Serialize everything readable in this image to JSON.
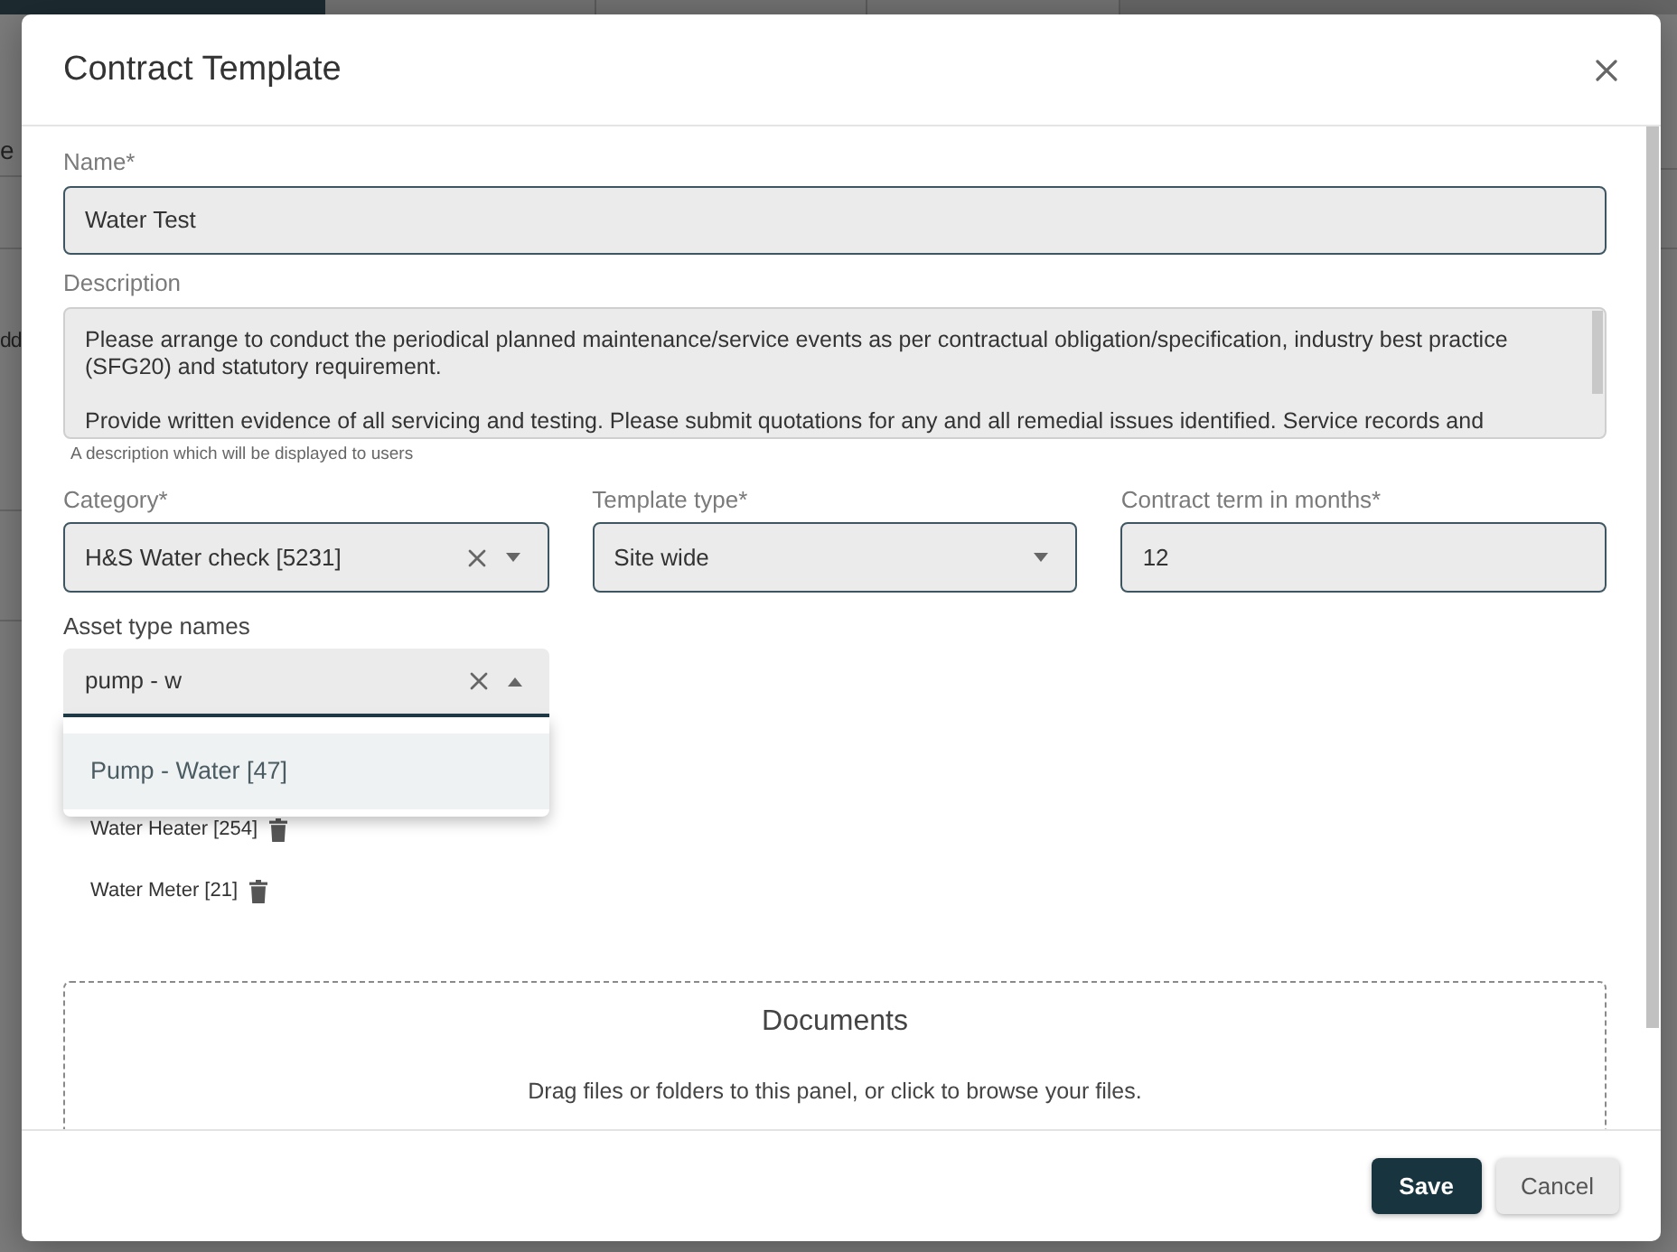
{
  "background_page": {
    "nav_tabs": [
      {
        "selected": true
      },
      {
        "selected": false
      },
      {
        "selected": false
      },
      {
        "selected": false
      }
    ],
    "text_fragments": [
      "e",
      "dd"
    ]
  },
  "dialog": {
    "title": "Contract Template"
  },
  "form": {
    "name": {
      "label": "Name*",
      "value": "Water Test"
    },
    "description": {
      "label": "Description",
      "value": "Please arrange to conduct the periodical planned maintenance/service events as per contractual obligation/specification, industry best practice (SFG20) and statutory requirement.\n\nProvide written evidence of all servicing and testing. Please submit quotations for any and all remedial issues identified. Service records and",
      "helper": "A description which will be displayed to users"
    },
    "fields_row": [
      {
        "label": "Category*",
        "value": "H&S Water check [5231]",
        "kind": "select",
        "clearable": true
      },
      {
        "label": "Template type*",
        "value": "Site wide",
        "kind": "select",
        "clearable": false
      },
      {
        "label": "Contract term in months*",
        "value": "12",
        "kind": "input"
      }
    ],
    "asset_type_names": {
      "label": "Asset type names",
      "value": "pump - w",
      "expanded": true,
      "options": [
        {
          "label": "Pump - Water [47]",
          "selected": true
        }
      ],
      "selected_items": [
        "Water Heater [254]",
        "Water Meter [21]"
      ]
    },
    "documents": {
      "title": "Documents",
      "hint": "Drag files or folders to this panel, or click to browse your files."
    }
  },
  "footer": {
    "buttons": [
      {
        "label": "Save",
        "kind": "primary"
      },
      {
        "label": "Cancel",
        "kind": "secondary"
      }
    ]
  }
}
